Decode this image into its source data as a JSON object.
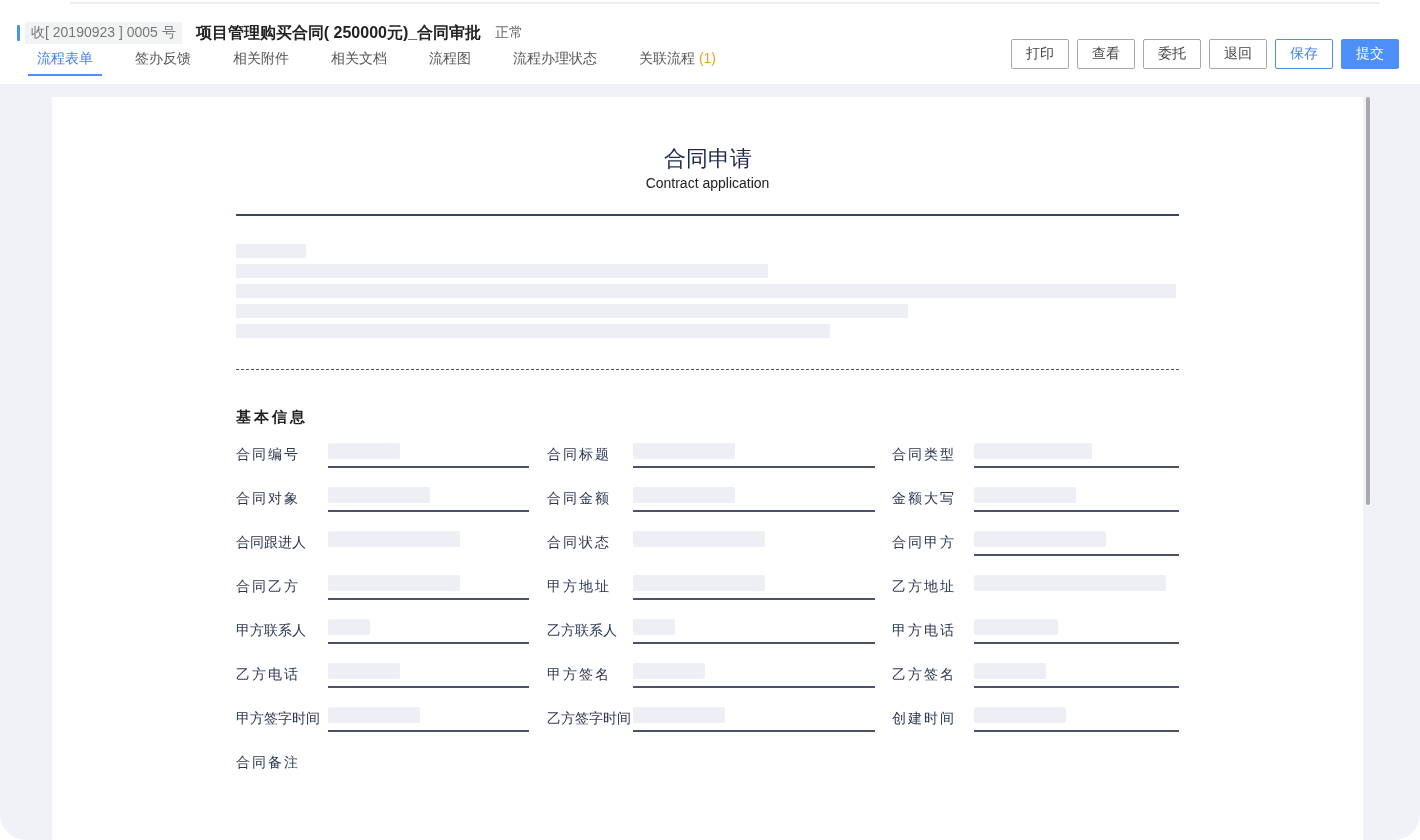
{
  "header": {
    "doc_number": "收[ 20190923 ] 0005 号",
    "title": "项目管理购买合同( 250000元)_合同审批",
    "status": "正常"
  },
  "tabs": [
    {
      "label": "流程表单",
      "selected": true
    },
    {
      "label": "签办反馈",
      "selected": false
    },
    {
      "label": "相关附件",
      "selected": false
    },
    {
      "label": "相关文档",
      "selected": false
    },
    {
      "label": "流程图",
      "selected": false
    },
    {
      "label": "流程办理状态",
      "selected": false
    },
    {
      "label": "关联流程",
      "count": "(1)",
      "selected": false
    }
  ],
  "buttons": [
    {
      "label": "打印",
      "kind": "default"
    },
    {
      "label": "查看",
      "kind": "default"
    },
    {
      "label": "委托",
      "kind": "default"
    },
    {
      "label": "退回",
      "kind": "default"
    },
    {
      "label": "保存",
      "kind": "outline"
    },
    {
      "label": "提交",
      "kind": "primary"
    }
  ],
  "form": {
    "title": "合同申请",
    "subtitle": "Contract application",
    "section_title": "基本信息",
    "fields": [
      {
        "label": "合同编号",
        "kind": "input",
        "underlined": true
      },
      {
        "label": "合同标题",
        "kind": "input",
        "underlined": true
      },
      {
        "label": "合同类型",
        "kind": "input",
        "underlined": true
      },
      {
        "label": "合同对象",
        "kind": "input",
        "underlined": true
      },
      {
        "label": "合同金额",
        "kind": "input",
        "underlined": true
      },
      {
        "label": "金额大写",
        "kind": "input",
        "underlined": true
      },
      {
        "label": "合同跟进人",
        "kind": "input",
        "underlined": false
      },
      {
        "label": "合同状态",
        "kind": "input",
        "underlined": false
      },
      {
        "label": "合同甲方",
        "kind": "input",
        "underlined": true
      },
      {
        "label": "合同乙方",
        "kind": "input",
        "underlined": true
      },
      {
        "label": "甲方地址",
        "kind": "input",
        "underlined": true
      },
      {
        "label": "乙方地址",
        "kind": "input",
        "underlined": false
      },
      {
        "label": "甲方联系人",
        "kind": "input",
        "underlined": true
      },
      {
        "label": "乙方联系人",
        "kind": "input",
        "underlined": true
      },
      {
        "label": "甲方电话",
        "kind": "input",
        "underlined": true
      },
      {
        "label": "乙方电话",
        "kind": "input",
        "underlined": true
      },
      {
        "label": "甲方签名",
        "kind": "input",
        "underlined": true
      },
      {
        "label": "乙方签名",
        "kind": "input",
        "underlined": true
      },
      {
        "label": "甲方签字时间",
        "kind": "input",
        "underlined": true
      },
      {
        "label": "乙方签字时间",
        "kind": "input",
        "underlined": true
      },
      {
        "label": "创建时间",
        "kind": "input",
        "underlined": true
      },
      {
        "label": "合同备注",
        "kind": "note"
      }
    ]
  }
}
